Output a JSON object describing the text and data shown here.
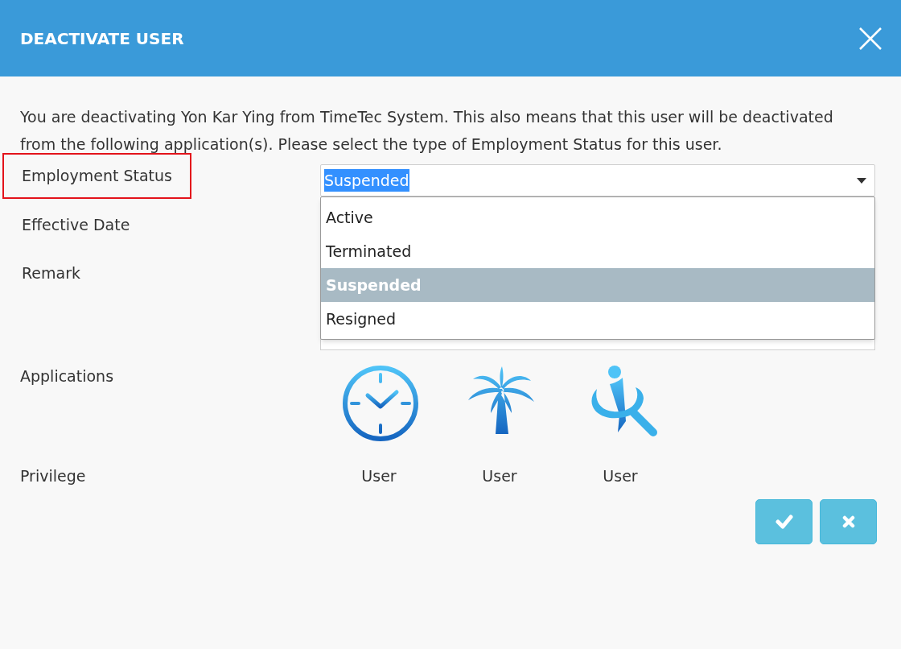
{
  "dialog": {
    "title": "DEACTIVATE USER"
  },
  "message": "You are deactivating Yon Kar Ying from TimeTec System. This also means that this user will be deactivated from the following application(s). Please select the type of Employment Status for this user.",
  "fields": [
    {
      "label": "Employment Status",
      "kind": "select",
      "highlighted": true,
      "value": "Suspended",
      "value_selected": true,
      "expanded": true,
      "options": [
        {
          "label": "Active",
          "selected": false
        },
        {
          "label": "Terminated",
          "selected": false
        },
        {
          "label": "Suspended",
          "selected": true
        },
        {
          "label": "Resigned",
          "selected": false
        }
      ]
    },
    {
      "label": "Effective Date",
      "kind": "input",
      "highlighted": false
    },
    {
      "label": "Remark",
      "kind": "textarea",
      "highlighted": false
    }
  ],
  "applications": {
    "label": "Applications",
    "apps": [
      {
        "kind": "clock"
      },
      {
        "kind": "palm"
      },
      {
        "kind": "person"
      }
    ]
  },
  "privilege": {
    "label": "Privilege",
    "values": [
      "User",
      "User",
      "User"
    ]
  },
  "buttons": [
    {
      "kind": "confirm"
    },
    {
      "kind": "cancel"
    }
  ]
}
